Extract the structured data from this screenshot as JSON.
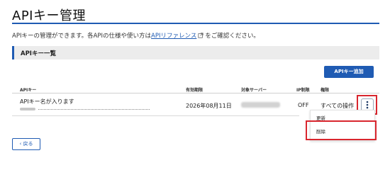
{
  "page": {
    "title": "APIキー管理",
    "intro_before": "APIキーの管理ができます。各APIの仕様や使い方は",
    "intro_link": "APIリファレンス",
    "intro_after": "をご確認ください。"
  },
  "section": {
    "title": "APIキー一覧"
  },
  "toolbar": {
    "add_label": "APIキー追加"
  },
  "table": {
    "headers": {
      "key": "APIキー",
      "expiry": "有効期限",
      "server": "対象サーバー",
      "ip": "IP制限",
      "permission": "権限"
    },
    "rows": [
      {
        "name": "APIキー名が入ります",
        "expiry": "2026年08月11日",
        "ip": "OFF",
        "permission": "すべての操作"
      }
    ]
  },
  "row_menu": {
    "items": [
      "更新",
      "削除"
    ]
  },
  "footer": {
    "back_label": "‹ 戻る"
  },
  "colors": {
    "accent": "#1f5bb3",
    "highlight": "#d9262e"
  },
  "icons": [
    "external-link-icon",
    "kebab-menu-icon"
  ]
}
